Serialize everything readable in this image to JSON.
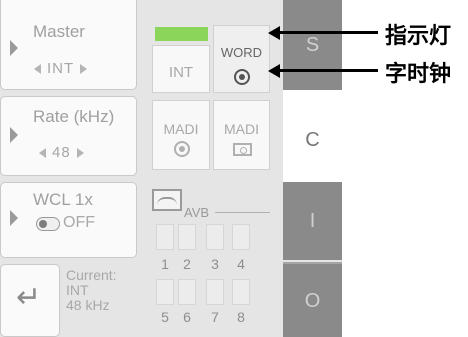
{
  "left": {
    "master": {
      "title": "Master",
      "value": "INT"
    },
    "rate": {
      "title": "Rate (kHz)",
      "value": "48"
    },
    "wcl": {
      "title": "WCL 1x",
      "toggle_label": "OFF"
    },
    "current": {
      "label": "Current:",
      "source": "INT",
      "rate": "48 kHz"
    }
  },
  "sync": {
    "int_label": "INT",
    "word_label": "WORD",
    "madi1_label": "MADI",
    "madi2_label": "MADI",
    "avb_label": "AVB",
    "channels": [
      "1",
      "2",
      "3",
      "4",
      "5",
      "6",
      "7",
      "8"
    ],
    "indicator_color": "#8bd55a"
  },
  "tabs": [
    {
      "label": "S"
    },
    {
      "label": "C"
    },
    {
      "label": "I"
    },
    {
      "label": "O"
    }
  ],
  "annotations": {
    "indicator": "指示灯",
    "clock": "字时钟"
  }
}
